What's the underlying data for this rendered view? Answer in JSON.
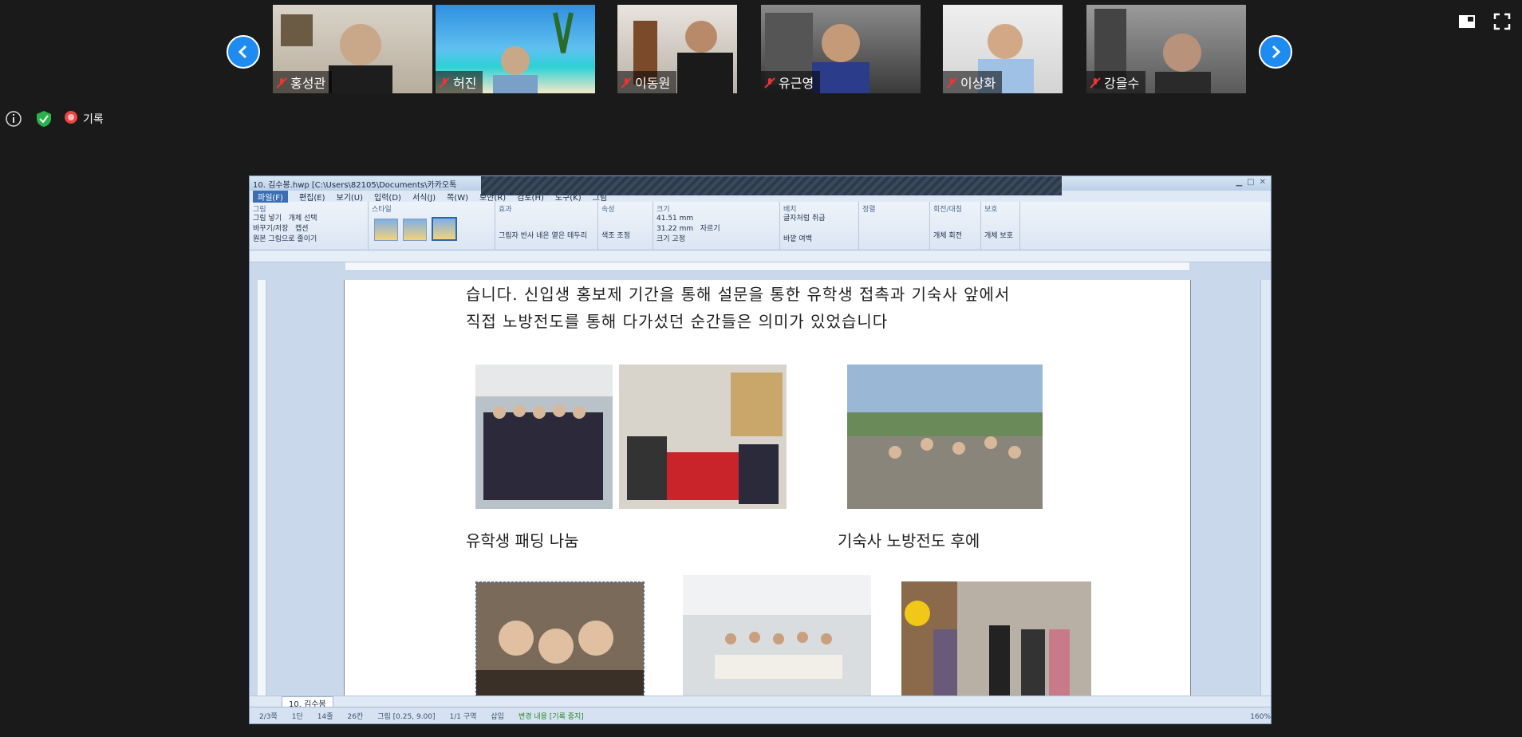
{
  "gallery": {
    "participants": [
      {
        "name": "홍성관"
      },
      {
        "name": "허진"
      },
      {
        "name": "이동원"
      },
      {
        "name": "유근영"
      },
      {
        "name": "이상화"
      },
      {
        "name": "강을수"
      }
    ],
    "prev_icon": "chevron-left-icon",
    "next_icon": "chevron-right-icon"
  },
  "meeting_status": {
    "record_label": "기록"
  },
  "editor": {
    "title": "10. 김수봉.hwp [C:\\Users\\82105\\Documents\\카카오톡",
    "menus": [
      "파일(F)",
      "편집(E)",
      "보기(U)",
      "입력(D)",
      "서식(J)",
      "쪽(W)",
      "보안(R)",
      "검토(H)",
      "도구(K)",
      "그림"
    ],
    "ribbon": {
      "group_picture": "그림",
      "insert_picture": "그림 넣기",
      "select_object": "개체 선택",
      "swap_save": "바꾸기/저장",
      "caption": "캡션",
      "original_picture": "원본 그림으로",
      "reduce": "줄이기",
      "group_style": "스타일",
      "group_effect": "효과",
      "shadow": "그림자",
      "reflection": "반사",
      "glow": "네온",
      "soft_edge": "옅은 테두리",
      "group_property": "속성",
      "color_adjust": "색조 조정",
      "group_size": "크기",
      "width_value": "41.51",
      "height_value": "31.22",
      "unit": "mm",
      "lock_size": "크기 고정",
      "crop": "자르기",
      "group_arrange": "배치",
      "treat_as_char": "글자처럼 취급",
      "outer_margin": "바깥 여백",
      "group_align": "정렬",
      "group_rotate": "회전/대칭",
      "rotate_object": "개체 회전",
      "group_protect": "보호",
      "protect_object": "개체 보호"
    },
    "document": {
      "line1": "습니다. 신입생 홍보제 기간을 통해 설문을 통한 유학생 접촉과 기숙사 앞에서",
      "line2": "직접 노방전도를 통해 다가섰던 순간들은 의미가 있었습니다",
      "caption1": "유학생 패딩 나눔",
      "caption2": "기숙사 노방전도 후에"
    },
    "tab_label": "10. 김수봉",
    "status": {
      "page": "2/3쪽",
      "section": "1단",
      "line": "14줄",
      "col": "26칸",
      "object": "그림 [0.25, 9.00]",
      "block": "1/1 구역",
      "mode": "삽입",
      "track": "변경 내용 [기록 중지]",
      "zoom": "160%"
    }
  }
}
